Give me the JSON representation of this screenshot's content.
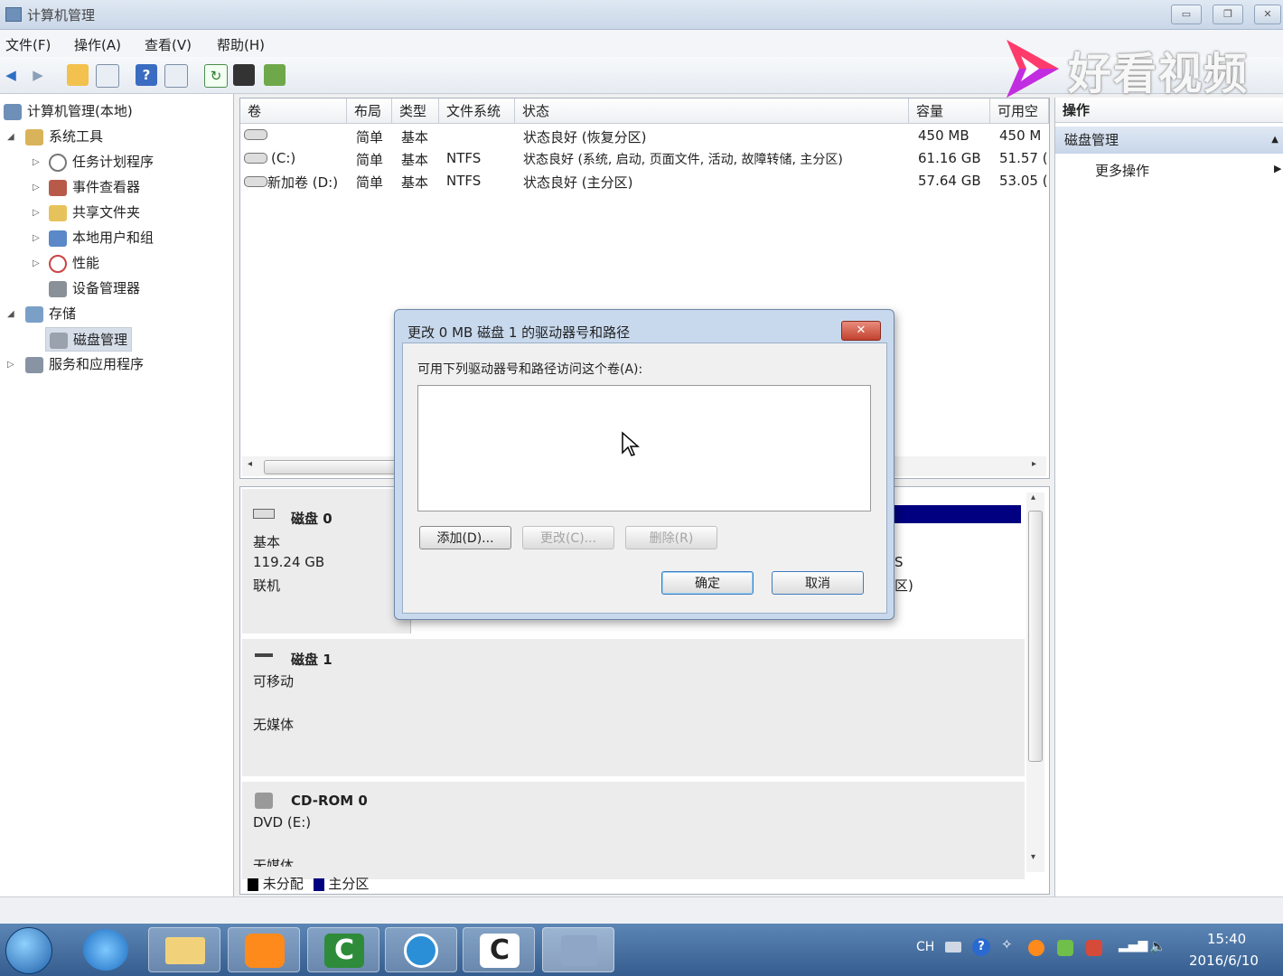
{
  "window": {
    "title": "计算机管理"
  },
  "menu": [
    "文件(F)",
    "操作(A)",
    "查看(V)",
    "帮助(H)"
  ],
  "watermark": {
    "text": "好看视频",
    "colors": [
      "#ff3b6b",
      "#b12bff"
    ]
  },
  "tree": {
    "root": "计算机管理(本地)",
    "system_tools": "系统工具",
    "task_scheduler": "任务计划程序",
    "event_viewer": "事件查看器",
    "shared_folders": "共享文件夹",
    "local_users": "本地用户和组",
    "performance": "性能",
    "device_manager": "设备管理器",
    "storage": "存储",
    "disk_management": "磁盘管理",
    "services_apps": "服务和应用程序"
  },
  "volume_list": {
    "headers": [
      "卷",
      "布局",
      "类型",
      "文件系统",
      "状态",
      "容量",
      "可用空"
    ],
    "rows": [
      {
        "volume": "",
        "layout": "简单",
        "type": "基本",
        "fs": "",
        "status": "状态良好 (恢复分区)",
        "capacity": "450 MB",
        "free": "450 M"
      },
      {
        "volume": "(C:)",
        "layout": "简单",
        "type": "基本",
        "fs": "NTFS",
        "status": "状态良好 (系统, 启动, 页面文件, 活动, 故障转储, 主分区)",
        "capacity": "61.16 GB",
        "free": "51.57 ("
      },
      {
        "volume": "新加卷 (D:)",
        "layout": "简单",
        "type": "基本",
        "fs": "NTFS",
        "status": "状态良好 (主分区)",
        "capacity": "57.64 GB",
        "free": "53.05 ("
      }
    ]
  },
  "disks": [
    {
      "name": "磁盘 0",
      "type": "基本",
      "size": "119.24 GB",
      "state": "联机"
    },
    {
      "name": "磁盘 1",
      "type": "可移动",
      "size": "",
      "state": "无媒体"
    },
    {
      "name": "CD-ROM 0",
      "type": "DVD (E:)",
      "size": "",
      "state": "无媒体"
    }
  ],
  "disk0_partial": {
    "line1": "S",
    "line2": "区)"
  },
  "legend": {
    "unallocated": "未分配",
    "primary": "主分区",
    "unallocated_color": "#000000",
    "primary_color": "#000080"
  },
  "actions": {
    "header": "操作",
    "section": "磁盘管理",
    "more": "更多操作"
  },
  "dialog": {
    "title": "更改 0 MB  磁盘 1 的驱动器号和路径",
    "label": "可用下列驱动器号和路径访问这个卷(A):",
    "add": "添加(D)...",
    "change": "更改(C)...",
    "remove": "删除(R)",
    "ok": "确定",
    "cancel": "取消"
  },
  "taskbar": {
    "lang": "CH",
    "time": "15:40",
    "date": "2016/6/10"
  }
}
